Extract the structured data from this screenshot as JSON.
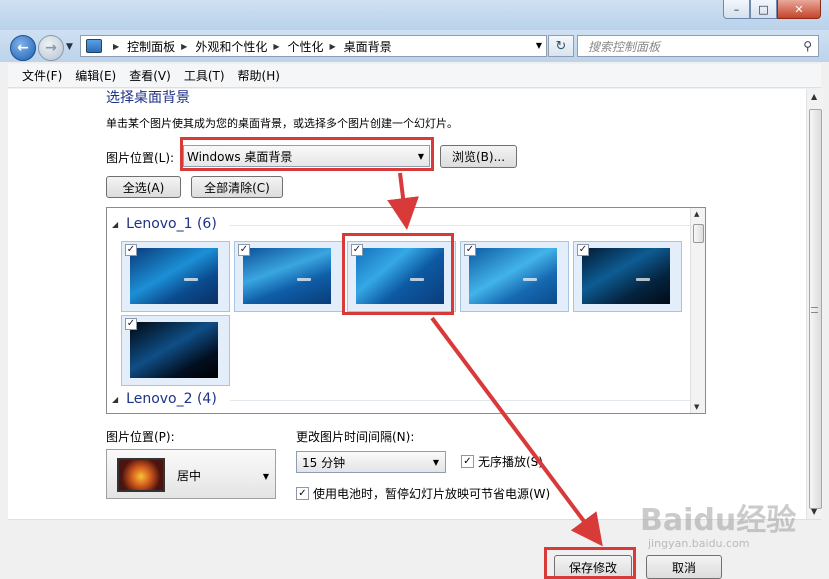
{
  "window": {
    "minimize": "–",
    "maximize": "□",
    "close": "✕"
  },
  "nav": {
    "breadcrumbs": [
      "控制面板",
      "外观和个性化",
      "个性化",
      "桌面背景"
    ],
    "search_placeholder": "搜索控制面板"
  },
  "menu": [
    "文件(F)",
    "编辑(E)",
    "查看(V)",
    "工具(T)",
    "帮助(H)"
  ],
  "page": {
    "heading": "选择桌面背景",
    "description": "单击某个图片使其成为您的桌面背景，或选择多个图片创建一个幻灯片。",
    "location_label": "图片位置(L):",
    "location_value": "Windows 桌面背景",
    "browse_label": "浏览(B)...",
    "select_all_label": "全选(A)",
    "clear_all_label": "全部清除(C)"
  },
  "gallery": {
    "groups": [
      {
        "name": "Lenovo_1 (6)"
      },
      {
        "name": "Lenovo_2 (4)"
      }
    ],
    "images_checked": [
      true,
      true,
      true,
      true,
      true,
      true
    ]
  },
  "settings": {
    "position_label": "图片位置(P):",
    "position_value": "居中",
    "interval_label": "更改图片时间间隔(N):",
    "interval_value": "15 分钟",
    "shuffle_label": "无序播放(S)",
    "shuffle_checked": true,
    "battery_label": "使用电池时，暂停幻灯片放映可节省电源(W)",
    "battery_checked": true
  },
  "footer": {
    "save_label": "保存修改",
    "cancel_label": "取消"
  },
  "watermark": {
    "text": "Baidu经验",
    "sub": "jingyan.baidu.com"
  },
  "colors": {
    "heading": "#1e3287",
    "annotation": "#d83a3a"
  }
}
